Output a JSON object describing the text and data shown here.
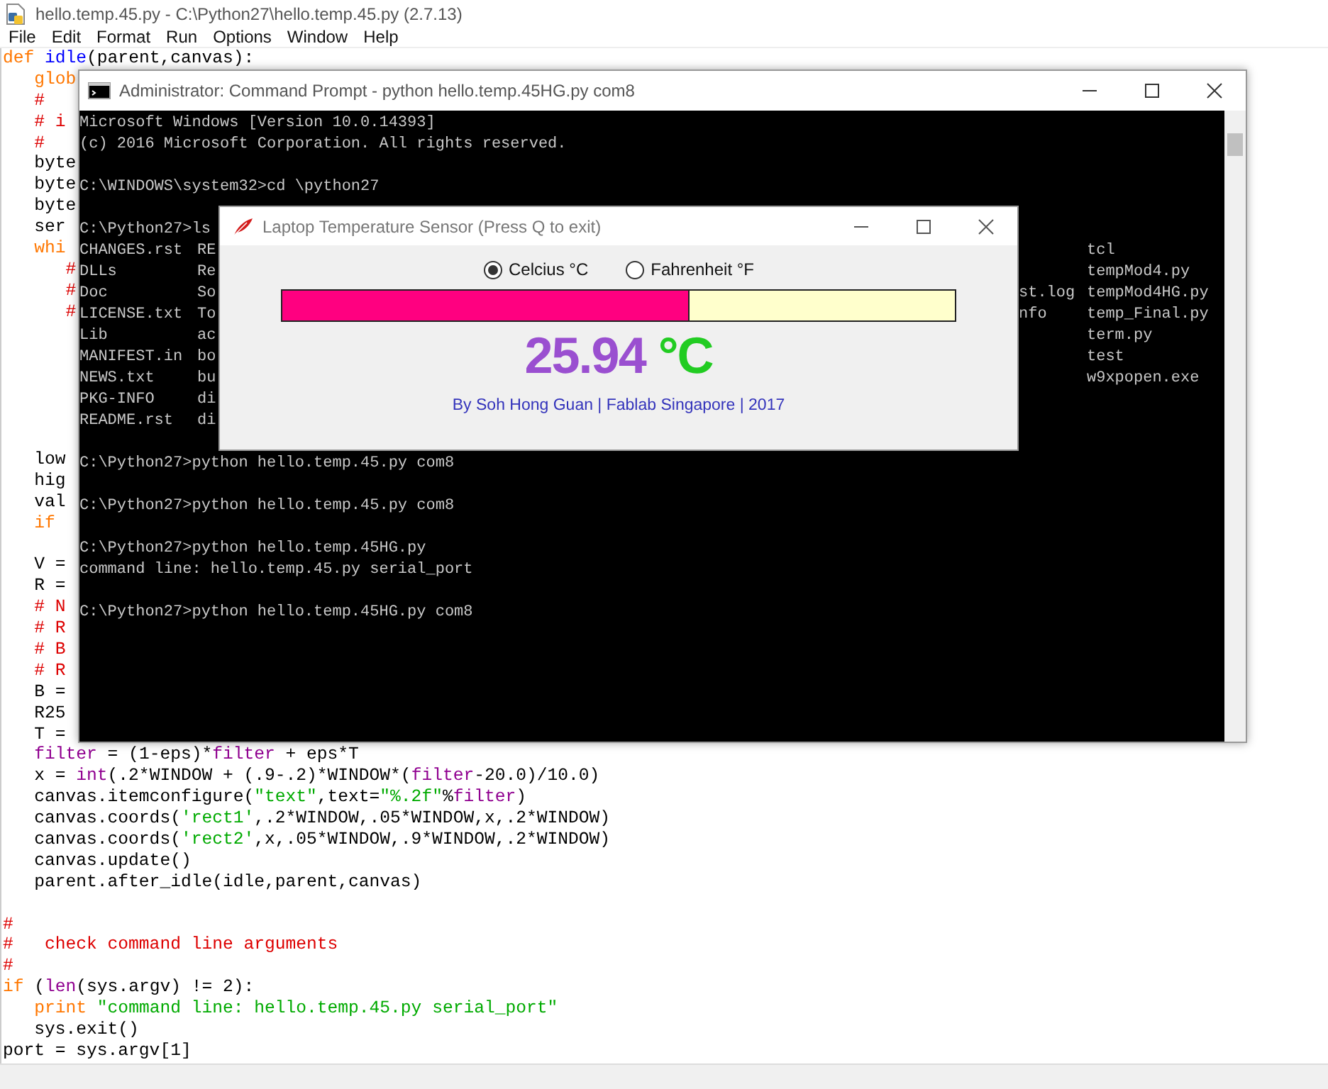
{
  "editor_window": {
    "title": "hello.temp.45.py - C:\\Python27\\hello.temp.45.py (2.7.13)",
    "menu": [
      "File",
      "Edit",
      "Format",
      "Run",
      "Options",
      "Window",
      "Help"
    ],
    "lines": [
      {
        "kind": "code",
        "segments": [
          {
            "text": "def",
            "kind": "keyword"
          },
          {
            "text": " idle",
            "kind": "definition"
          },
          {
            "text": "(parent,canvas):",
            "kind": "plain"
          }
        ]
      },
      {
        "kind": "code",
        "segments": [
          {
            "text": "   glob",
            "kind": "keyword"
          }
        ]
      },
      {
        "kind": "code",
        "segments": [
          {
            "text": "   #",
            "kind": "comment"
          }
        ]
      },
      {
        "kind": "code",
        "segments": [
          {
            "text": "   # i",
            "kind": "comment"
          }
        ]
      },
      {
        "kind": "code",
        "segments": [
          {
            "text": "   #",
            "kind": "comment"
          }
        ]
      },
      {
        "kind": "code",
        "segments": [
          {
            "text": "   byte",
            "kind": "plain"
          }
        ]
      },
      {
        "kind": "code",
        "segments": [
          {
            "text": "   byte",
            "kind": "plain"
          }
        ]
      },
      {
        "kind": "code",
        "segments": [
          {
            "text": "   byte",
            "kind": "plain"
          }
        ]
      },
      {
        "kind": "code",
        "segments": [
          {
            "text": "   ser",
            "kind": "plain"
          }
        ]
      },
      {
        "kind": "code",
        "segments": [
          {
            "text": "   whi",
            "kind": "keyword"
          }
        ]
      },
      {
        "kind": "code",
        "segments": [
          {
            "text": "      #",
            "kind": "comment"
          }
        ]
      },
      {
        "kind": "code",
        "segments": [
          {
            "text": "      #",
            "kind": "comment"
          }
        ]
      },
      {
        "kind": "code",
        "segments": [
          {
            "text": "      #",
            "kind": "comment"
          }
        ]
      },
      {
        "kind": "blank"
      },
      {
        "kind": "blank"
      },
      {
        "kind": "blank"
      },
      {
        "kind": "blank"
      },
      {
        "kind": "blank"
      },
      {
        "kind": "blank"
      },
      {
        "kind": "code",
        "segments": [
          {
            "text": "   low",
            "kind": "plain"
          }
        ]
      },
      {
        "kind": "code",
        "segments": [
          {
            "text": "   hig",
            "kind": "plain"
          }
        ]
      },
      {
        "kind": "code",
        "segments": [
          {
            "text": "   val",
            "kind": "plain"
          }
        ]
      },
      {
        "kind": "code",
        "segments": [
          {
            "text": "   if",
            "kind": "keyword"
          }
        ]
      },
      {
        "kind": "blank"
      },
      {
        "kind": "code",
        "segments": [
          {
            "text": "   V =",
            "kind": "plain"
          }
        ]
      },
      {
        "kind": "code",
        "segments": [
          {
            "text": "   R =",
            "kind": "plain"
          }
        ]
      },
      {
        "kind": "code",
        "segments": [
          {
            "text": "   # N",
            "kind": "comment"
          }
        ]
      },
      {
        "kind": "code",
        "segments": [
          {
            "text": "   # R",
            "kind": "comment"
          }
        ]
      },
      {
        "kind": "code",
        "segments": [
          {
            "text": "   # B",
            "kind": "comment"
          }
        ]
      },
      {
        "kind": "code",
        "segments": [
          {
            "text": "   # R",
            "kind": "comment"
          }
        ]
      },
      {
        "kind": "code",
        "segments": [
          {
            "text": "   B =",
            "kind": "plain"
          }
        ]
      },
      {
        "kind": "code",
        "segments": [
          {
            "text": "   R25",
            "kind": "plain"
          }
        ]
      },
      {
        "kind": "code",
        "segments": [
          {
            "text": "   T =",
            "kind": "plain"
          }
        ]
      },
      {
        "kind": "code",
        "segments": [
          {
            "text": "   filter",
            "kind": "builtin"
          },
          {
            "text": " = (1-eps)*",
            "kind": "plain"
          },
          {
            "text": "filter",
            "kind": "builtin"
          },
          {
            "text": " + eps*T",
            "kind": "plain"
          }
        ]
      },
      {
        "kind": "code",
        "segments": [
          {
            "text": "   x = ",
            "kind": "plain"
          },
          {
            "text": "int",
            "kind": "builtin"
          },
          {
            "text": "(.2*WINDOW + (.9-.2)*WINDOW*(",
            "kind": "plain"
          },
          {
            "text": "filter",
            "kind": "builtin"
          },
          {
            "text": "-20.0)/10.0)",
            "kind": "plain"
          }
        ]
      },
      {
        "kind": "code",
        "segments": [
          {
            "text": "   canvas.itemconfigure(",
            "kind": "plain"
          },
          {
            "text": "\"text\"",
            "kind": "string"
          },
          {
            "text": ",text=",
            "kind": "plain"
          },
          {
            "text": "\"%.2f\"",
            "kind": "string"
          },
          {
            "text": "%",
            "kind": "plain"
          },
          {
            "text": "filter",
            "kind": "builtin"
          },
          {
            "text": ")",
            "kind": "plain"
          }
        ]
      },
      {
        "kind": "code",
        "segments": [
          {
            "text": "   canvas.coords(",
            "kind": "plain"
          },
          {
            "text": "'rect1'",
            "kind": "string"
          },
          {
            "text": ",.2*WINDOW,.05*WINDOW,x,.2*WINDOW)",
            "kind": "plain"
          }
        ]
      },
      {
        "kind": "code",
        "segments": [
          {
            "text": "   canvas.coords(",
            "kind": "plain"
          },
          {
            "text": "'rect2'",
            "kind": "string"
          },
          {
            "text": ",x,.05*WINDOW,.9*WINDOW,.2*WINDOW)",
            "kind": "plain"
          }
        ]
      },
      {
        "kind": "code",
        "segments": [
          {
            "text": "   canvas.update()",
            "kind": "plain"
          }
        ]
      },
      {
        "kind": "code",
        "segments": [
          {
            "text": "   parent.after_idle(idle,parent,canvas)",
            "kind": "plain"
          }
        ]
      },
      {
        "kind": "blank"
      },
      {
        "kind": "code",
        "segments": [
          {
            "text": "#",
            "kind": "comment"
          }
        ]
      },
      {
        "kind": "code",
        "segments": [
          {
            "text": "#   check command line arguments",
            "kind": "comment"
          }
        ]
      },
      {
        "kind": "code",
        "segments": [
          {
            "text": "#",
            "kind": "comment"
          }
        ]
      },
      {
        "kind": "code",
        "segments": [
          {
            "text": "if",
            "kind": "keyword"
          },
          {
            "text": " (",
            "kind": "plain"
          },
          {
            "text": "len",
            "kind": "builtin"
          },
          {
            "text": "(sys.argv) != 2):",
            "kind": "plain"
          }
        ]
      },
      {
        "kind": "code",
        "segments": [
          {
            "text": "   print",
            "kind": "keyword"
          },
          {
            "text": " \"command line: hello.temp.45.py serial_port\"",
            "kind": "string"
          }
        ]
      },
      {
        "kind": "code",
        "segments": [
          {
            "text": "   sys.exit()",
            "kind": "plain"
          }
        ]
      },
      {
        "kind": "code",
        "segments": [
          {
            "text": "port = sys.argv[1]",
            "kind": "plain"
          }
        ]
      }
    ]
  },
  "console_window": {
    "title": "Administrator: Command Prompt - python  hello.temp.45HG.py com8",
    "lines": [
      {
        "kind": "text",
        "text": "Microsoft Windows [Version 10.0.14393]"
      },
      {
        "kind": "text",
        "text": "(c) 2016 Microsoft Corporation. All rights reserved."
      },
      {
        "kind": "blank"
      },
      {
        "kind": "text",
        "text": "C:\\WINDOWS\\system32>cd \\python27"
      },
      {
        "kind": "blank"
      },
      {
        "kind": "text",
        "text": "C:\\Python27>ls"
      },
      {
        "kind": "listing",
        "column_1": "CHANGES.rst",
        "column_2": "RE",
        "column_4": "tcl"
      },
      {
        "kind": "listing",
        "column_1": "DLLs",
        "column_2": "Re",
        "column_4": "tempMod4.py"
      },
      {
        "kind": "listing",
        "column_1": "Doc",
        "column_2": "So",
        "column_3": "st.log",
        "column_4": "tempMod4HG.py"
      },
      {
        "kind": "listing",
        "column_1": "LICENSE.txt",
        "column_2": "To",
        "column_3": "nfo",
        "column_4": "temp_Final.py"
      },
      {
        "kind": "listing",
        "column_1": "Lib",
        "column_2": "ac",
        "column_4": "term.py"
      },
      {
        "kind": "listing",
        "column_1": "MANIFEST.in",
        "column_2": "bo",
        "column_4": "test"
      },
      {
        "kind": "listing",
        "column_1": "NEWS.txt",
        "column_2": "bu",
        "column_4": "w9xpopen.exe"
      },
      {
        "kind": "listing",
        "column_1": "PKG-INFO",
        "column_2": "di"
      },
      {
        "kind": "listing",
        "column_1": "README.rst",
        "column_2": "di"
      },
      {
        "kind": "blank"
      },
      {
        "kind": "text",
        "text": "C:\\Python27>python hello.temp.45.py com8"
      },
      {
        "kind": "blank"
      },
      {
        "kind": "text",
        "text": "C:\\Python27>python hello.temp.45.py com8"
      },
      {
        "kind": "blank"
      },
      {
        "kind": "text",
        "text": "C:\\Python27>python hello.temp.45HG.py"
      },
      {
        "kind": "text",
        "text": "command line: hello.temp.45.py serial_port"
      },
      {
        "kind": "blank"
      },
      {
        "kind": "text",
        "text": "C:\\Python27>python hello.temp.45HG.py com8"
      }
    ]
  },
  "sensor_window": {
    "title": "Laptop Temperature Sensor (Press Q to exit)",
    "units": [
      {
        "label": "Celcius °C",
        "selected": true
      },
      {
        "label": "Fahrenheit °F",
        "selected": false
      }
    ],
    "bar": {
      "level": 0.605
    },
    "reading": "25.94",
    "unit": "°C",
    "credit": "By Soh Hong Guan | Fablab Singapore | 2017"
  }
}
